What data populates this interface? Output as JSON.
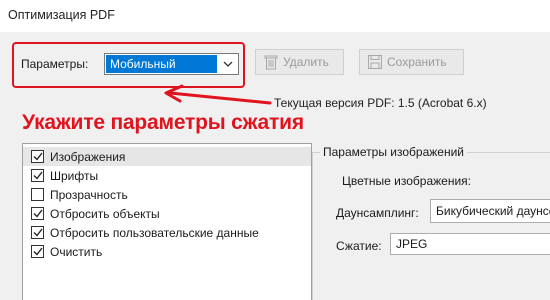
{
  "window": {
    "title": "Оптимизация PDF"
  },
  "toolbar": {
    "params_label": "Параметры:",
    "params_value": "Мобильный",
    "delete_label": "Удалить",
    "save_label": "Сохранить"
  },
  "version_text": "Текущая версия PDF: 1.5 (Acrobat 6.x)",
  "annotation": {
    "hint": "Укажите параметры сжатия",
    "color": "#e0141f"
  },
  "list": {
    "items": [
      {
        "label": "Изображения",
        "checked": true,
        "selected": true
      },
      {
        "label": "Шрифты",
        "checked": true,
        "selected": false
      },
      {
        "label": "Прозрачность",
        "checked": false,
        "selected": false
      },
      {
        "label": "Отбросить объекты",
        "checked": true,
        "selected": false
      },
      {
        "label": "Отбросить пользовательские данные",
        "checked": true,
        "selected": false
      },
      {
        "label": "Очистить",
        "checked": true,
        "selected": false
      }
    ]
  },
  "image_settings": {
    "group_title": "Параметры изображений",
    "color_images_label": "Цветные изображения:",
    "downsampling_label": "Даунсамплинг:",
    "downsampling_value": "Бикубический даунсемплинг",
    "compression_label": "Сжатие:",
    "compression_value": "JPEG"
  },
  "colors": {
    "accent": "#0078d7",
    "annotation": "#e0141f"
  }
}
